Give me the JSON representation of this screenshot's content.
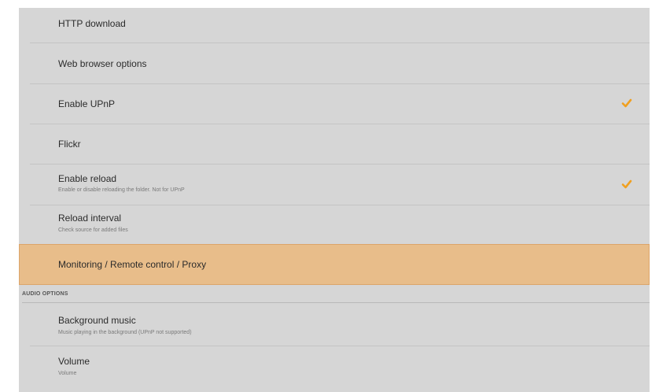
{
  "settings": {
    "http_download": {
      "title": "HTTP download"
    },
    "web_browser_options": {
      "title": "Web browser options"
    },
    "enable_upnp": {
      "title": "Enable UPnP",
      "checked": true
    },
    "flickr": {
      "title": "Flickr"
    },
    "enable_reload": {
      "title": "Enable reload",
      "subtitle": "Enable or disable reloading the folder. Not for UPnP",
      "checked": true
    },
    "reload_interval": {
      "title": "Reload interval",
      "subtitle": "Check source for added files"
    },
    "monitoring": {
      "title": "Monitoring / Remote control / Proxy",
      "selected": true
    }
  },
  "audio_options": {
    "header": "AUDIO OPTIONS",
    "background_music": {
      "title": "Background music",
      "subtitle": "Music playing in the background (UPnP not supported)"
    },
    "volume": {
      "title": "Volume",
      "subtitle": "Volume"
    }
  },
  "colors": {
    "panel_bg": "#d6d6d6",
    "selected_bg": "#e8bd8a",
    "check_accent": "#f0a020"
  },
  "icons": {
    "checkmark": "check-icon"
  }
}
